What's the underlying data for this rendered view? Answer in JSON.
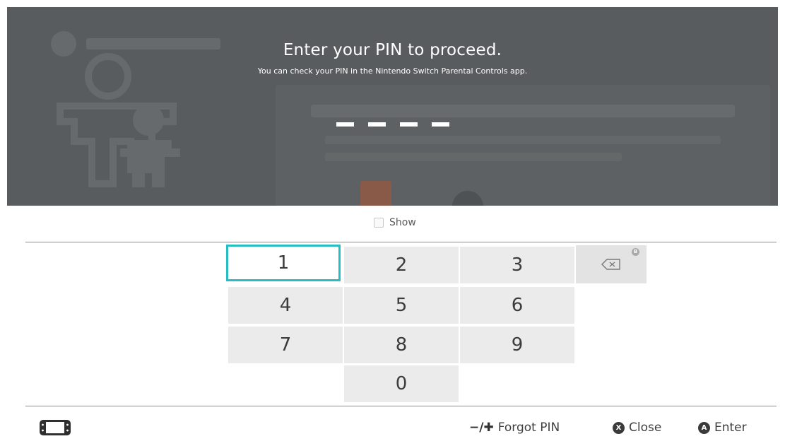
{
  "dialog": {
    "heading": "Enter your PIN to proceed.",
    "subheading": "You can check your PIN in the Nintendo Switch Parental Controls app.",
    "pin_length": 4,
    "entered_digits": 0
  },
  "show_toggle": {
    "label": "Show",
    "checked": false
  },
  "keypad": {
    "keys": [
      "1",
      "2",
      "3",
      "4",
      "5",
      "6",
      "7",
      "8",
      "9",
      "0"
    ],
    "selected_key": "1",
    "backspace_icon": "backspace-icon",
    "backspace_badge": "B"
  },
  "footer": {
    "console_icon": "handheld-console-icon",
    "forgot_glyph": "−/✚",
    "forgot_label": "Forgot PIN",
    "close_button_glyph": "X",
    "close_label": "Close",
    "enter_button_glyph": "A",
    "enter_label": "Enter"
  },
  "colors": {
    "overlay": "#595c5e",
    "accent_selection": "#26bdc3",
    "key_background": "#ebebeb",
    "text_dark": "#3c3c3c"
  }
}
